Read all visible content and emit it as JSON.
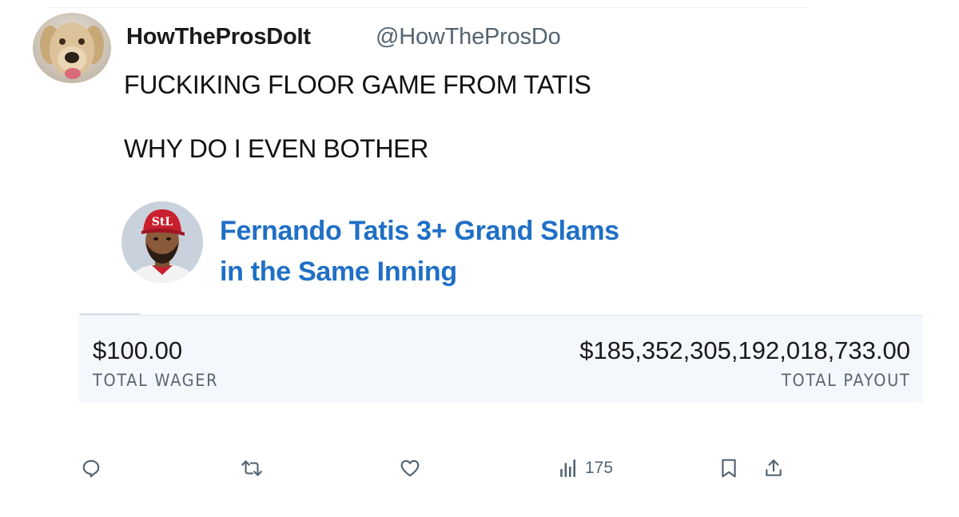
{
  "tweet": {
    "display_name": "HowTheProsDoIt",
    "handle": "@HowTheProsDo",
    "lines": [
      "FUCKIKING FLOOR GAME FROM TATIS",
      "WHY DO I EVEN BOTHER"
    ],
    "avatar_icon": "dog-avatar-icon"
  },
  "bet_card": {
    "player_avatar_icon": "baseball-player-avatar-icon",
    "title_line1": "Fernando Tatis 3+ Grand Slams",
    "title_line2": "in the Same Inning",
    "wager_value": "$100.00",
    "wager_label": "TOTAL WAGER",
    "payout_value": "$185,352,305,192,018,733.00",
    "payout_label": "TOTAL PAYOUT",
    "title_color": "#1f6fc6"
  },
  "actions": {
    "reply_icon": "reply-icon",
    "retweet_icon": "retweet-icon",
    "like_icon": "heart-icon",
    "views_icon": "views-chart-icon",
    "views_count": "175",
    "bookmark_icon": "bookmark-icon",
    "share_icon": "share-icon",
    "icon_color": "#536471"
  }
}
